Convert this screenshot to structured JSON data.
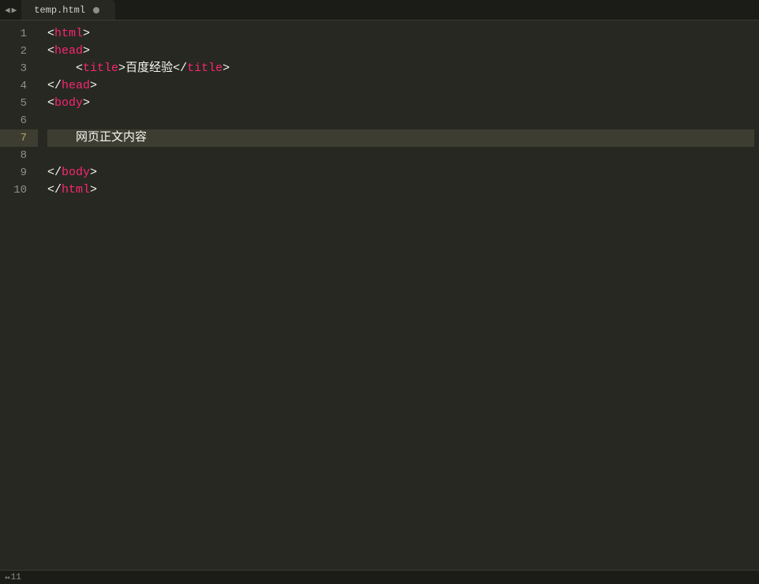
{
  "tabs": {
    "nav_back": "◀",
    "nav_fwd": "▶",
    "items": [
      {
        "label": "temp.html",
        "dirty": true
      }
    ]
  },
  "gutter": {
    "lines": [
      "1",
      "2",
      "3",
      "4",
      "5",
      "6",
      "7",
      "8",
      "9",
      "10"
    ],
    "current_index": 6
  },
  "code": {
    "l1": {
      "open": "<",
      "tag": "html",
      "close": ">"
    },
    "l2": {
      "open": "<",
      "tag": "head",
      "close": ">"
    },
    "l3": {
      "open": "<",
      "tag": "title",
      "mid": ">",
      "text": "百度经验",
      "copen": "</",
      "ctag": "title",
      "cclose": ">"
    },
    "l4": {
      "open": "</",
      "tag": "head",
      "close": ">"
    },
    "l5": {
      "open": "<",
      "tag": "body",
      "close": ">"
    },
    "l6": {
      "blank": ""
    },
    "l7": {
      "text": "网页正文内容"
    },
    "l8": {
      "blank": ""
    },
    "l9": {
      "open": "</",
      "tag": "body",
      "close": ">"
    },
    "l10": {
      "open": "</",
      "tag": "html",
      "close": ">"
    }
  },
  "status": {
    "arrow": "↔",
    "line": "11"
  }
}
